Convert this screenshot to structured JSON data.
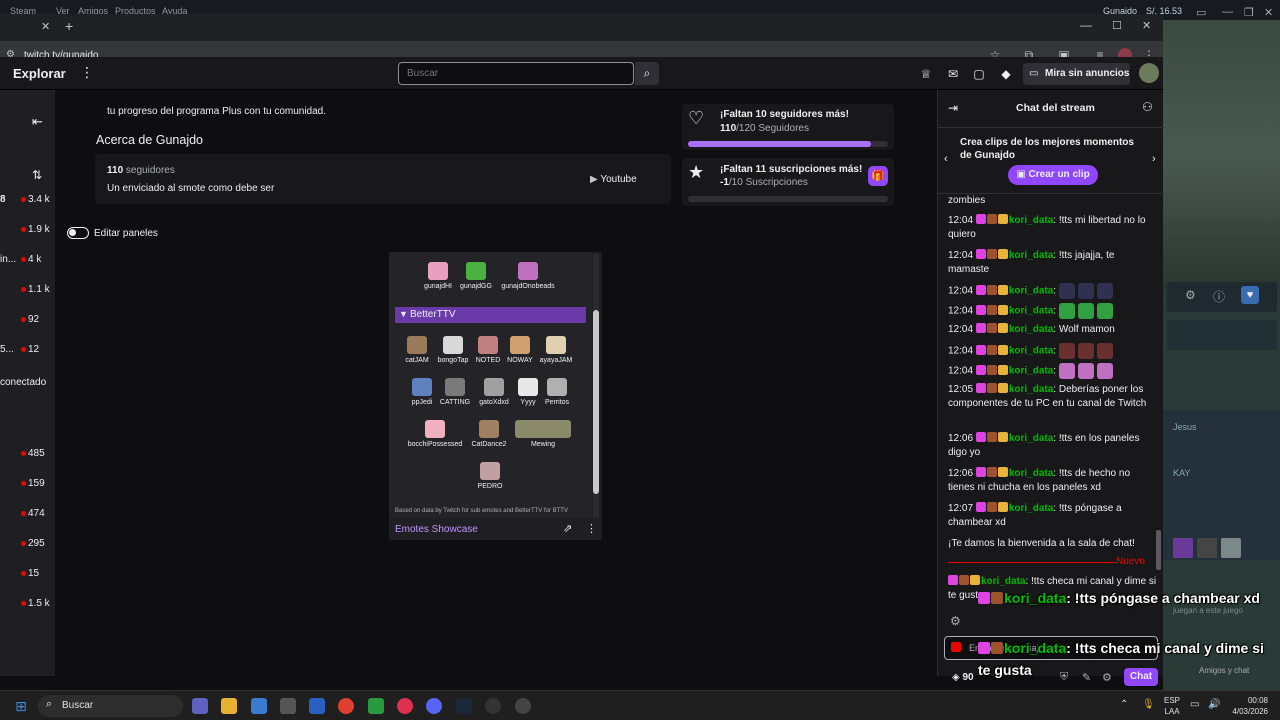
{
  "steam": {
    "menu": [
      "Steam",
      "Ver",
      "Amigos",
      "Productos",
      "Ayuda"
    ],
    "user": "Gunajdo",
    "balance": "S/. 16.53",
    "friends_label": "Amigos y chat"
  },
  "browser": {
    "url": "twitch.tv/gunajdo"
  },
  "nav": {
    "explorar": "Explorar",
    "search_placeholder": "Buscar",
    "turbo": "Mira sin anuncios"
  },
  "left_rail": {
    "items": [
      {
        "prefix": "8",
        "value": "3.4 k"
      },
      {
        "prefix": "",
        "value": "1.9 k"
      },
      {
        "prefix": "in...",
        "value": "4 k"
      },
      {
        "prefix": "",
        "value": "1.1 k"
      },
      {
        "prefix": "",
        "value": "92"
      },
      {
        "prefix": "5...",
        "value": "12"
      },
      {
        "prefix": "",
        "value": "485"
      },
      {
        "prefix": "",
        "value": "159"
      },
      {
        "prefix": "",
        "value": "474"
      },
      {
        "prefix": "",
        "value": "295"
      },
      {
        "prefix": "",
        "value": "15"
      },
      {
        "prefix": "",
        "value": "1.5 k"
      }
    ],
    "offline_label": "conectado"
  },
  "about": {
    "plus_text": "tu progreso del programa Plus con tu comunidad.",
    "heading": "Acerca de Gunajdo",
    "followers_count": "110",
    "followers_label": "seguidores",
    "bio": "Un enviciado al smote como debe ser",
    "youtube": "Youtube",
    "edit_panels": "Editar paneles"
  },
  "goals": {
    "followers_title": "¡Faltan 10 seguidores más!",
    "followers_progress": "110",
    "followers_label": "/120 Seguidores",
    "followers_fraction": 0.917,
    "subs_title": "¡Faltan 11 suscripciones más!",
    "subs_progress": "-1",
    "subs_label": "/10 Suscripciones",
    "subs_fraction": 0.0
  },
  "emotes": {
    "channel_emotes": [
      "gunajdHI",
      "gunajdGG",
      "gunajdOnobeads"
    ],
    "bttv_header": "BetterTTV",
    "bttv_emotes": [
      "catJAM",
      "bongoTap",
      "NOTED",
      "NOWAY",
      "ayayaJAM",
      "ppJedi",
      "CATTING",
      "gatoXdxd",
      "Yyyy",
      "Perritos",
      "bocchiPossessed",
      "CatDance2",
      "Mewing",
      "PEDRO"
    ],
    "footer_note": "Based on data by Twitch for sub emotes and BetterTTV for BTTV",
    "showcase_label": "Emotes Showcase"
  },
  "chat": {
    "header": "Chat del stream",
    "clip_promo": "Crea clips de los mejores momentos de Gunajdo",
    "clip_button": "Crear un clip",
    "top_fragment": "zombies",
    "messages": [
      {
        "time": "12:04",
        "user": "kori_data",
        "text": "!tts mi libertad no lo quiero"
      },
      {
        "time": "12:04",
        "user": "kori_data",
        "text": "!tts jajajja, te mamaste"
      },
      {
        "time": "12:04",
        "user": "kori_data",
        "text": ""
      },
      {
        "time": "12:04",
        "user": "kori_data",
        "text": ""
      },
      {
        "time": "12:04",
        "user": "kori_data",
        "text": "Wolf mamon"
      },
      {
        "time": "12:04",
        "user": "kori_data",
        "text": ""
      },
      {
        "time": "12:04",
        "user": "kori_data",
        "text": ""
      },
      {
        "time": "12:05",
        "user": "kori_data",
        "text": "Deberías poner los componentes de tu PC en tu canal de Twitch"
      },
      {
        "time": "12:06",
        "user": "kori_data",
        "text": "!tts en los paneles digo yo"
      },
      {
        "time": "12:06",
        "user": "kori_data",
        "text": "!tts de hecho no tienes ni chucha en los paneles xd"
      },
      {
        "time": "12:07",
        "user": "kori_data",
        "text": "!tts póngase a chambear xd"
      }
    ],
    "welcome": "¡Te damos la bienvenida a la sala de chat!",
    "new_label": "Nuevo",
    "last_message": {
      "user": "kori_data",
      "text": "!tts checa mi canal y dime si te gusta"
    },
    "input_placeholder": "Enviar un mensaje",
    "points": "90",
    "chat_button": "Chat"
  },
  "overlay": {
    "line1_user": "kori_data",
    "line1_text": ": !tts póngase a chambear xd",
    "line2_user": "kori_data",
    "line2_text": ": !tts checa mi canal y dime si te gusta"
  },
  "taskbar": {
    "search": "Buscar",
    "lang_top": "ESP",
    "lang_bottom": "LAA",
    "time": "00:08",
    "date": "4/03/2026"
  },
  "steam_side": {
    "fragment_jesus": "Jesus",
    "fragment_kay": "KAY",
    "fragment_juego": "juegan a este juego"
  }
}
